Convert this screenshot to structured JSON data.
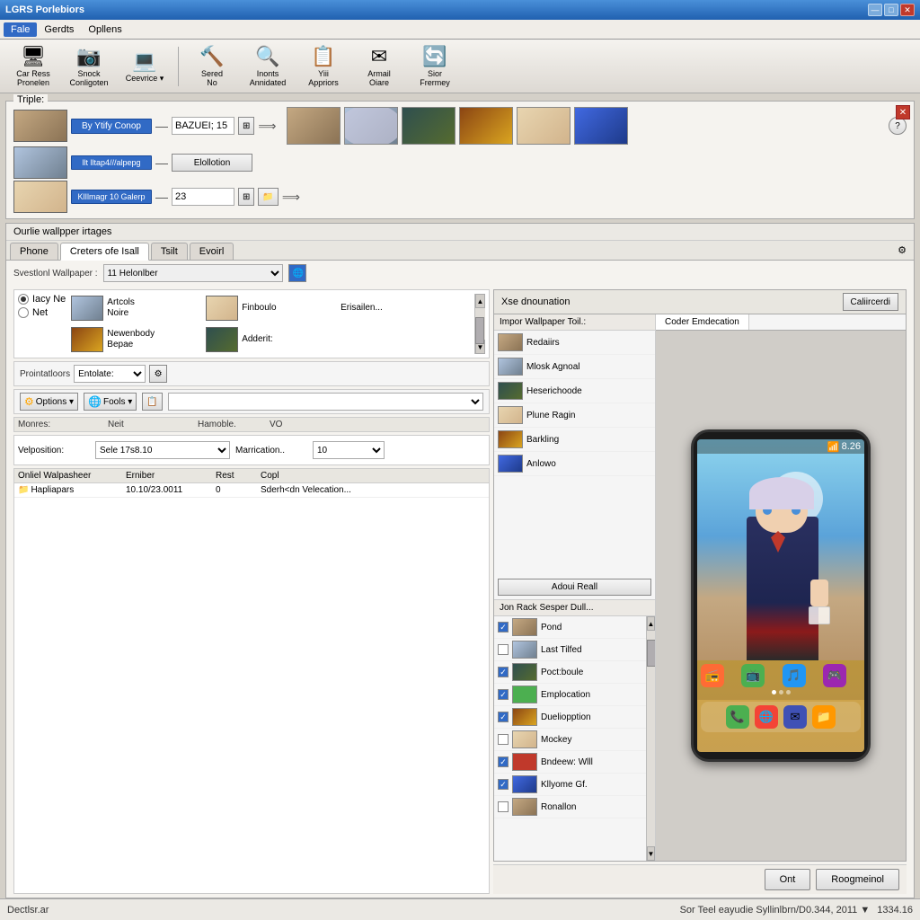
{
  "window": {
    "title": "LGRS Porlebiors",
    "controls": {
      "min": "—",
      "max": "□",
      "close": "✕"
    }
  },
  "menubar": {
    "items": [
      "Fale",
      "Gerdts",
      "Opllens"
    ]
  },
  "toolbar": {
    "buttons": [
      {
        "label": "Car Ress\nPronelen",
        "icon": "🖥"
      },
      {
        "label": "Snock\nConligoten",
        "icon": "📷"
      },
      {
        "label": "Ceevrice",
        "icon": "💻"
      },
      {
        "label": "Sered\nNo",
        "icon": "🔨"
      },
      {
        "label": "Inonts\nAnnidated",
        "icon": "🔍"
      },
      {
        "label": "Yiii\nAppriors",
        "icon": "📋"
      },
      {
        "label": "Armail\nOiare",
        "icon": "✉"
      },
      {
        "label": "Sior\nFrermey",
        "icon": "🔄"
      }
    ]
  },
  "triple_panel": {
    "title": "Triple:",
    "rows": [
      {
        "label": "By Ytify Conop",
        "value": "BAZUEI; 15"
      },
      {
        "label": "llt lltap4///alpepg",
        "btn": "Elollotion"
      },
      {
        "label": "KlIlmagr 10 Galerp",
        "value": "23"
      }
    ]
  },
  "strip_thumbs": [
    {
      "id": 1
    },
    {
      "id": 2
    },
    {
      "id": 3
    },
    {
      "id": 4
    },
    {
      "id": 5
    },
    {
      "id": 6
    }
  ],
  "wallpaper_section": {
    "title": "Ourlie wallpper irtages",
    "tabs": [
      "Phone",
      "Creters ofe Isall",
      "Tsilt",
      "Evoirl"
    ]
  },
  "section_dropdown": {
    "label": "Svestlonl Wallpaper :",
    "value": "11 Helonlber"
  },
  "left_items_grid": [
    {
      "name": "Artcols Noire",
      "has_thumb": true
    },
    {
      "name": "Finboulo",
      "has_thumb": true
    },
    {
      "name": "Erisailen...",
      "has_thumb": false
    },
    {
      "name": "Newenbody\nBepae",
      "has_thumb": true
    },
    {
      "name": "Adderit:",
      "has_thumb": true
    }
  ],
  "radio_items": [
    {
      "label": "Iacy Ne"
    },
    {
      "label": "Net"
    }
  ],
  "params_row": {
    "label": "Prointatloors",
    "dropdown": "Entolate:"
  },
  "options_row": {
    "options_label": "Options",
    "fools_label": "Fools"
  },
  "table": {
    "columns": [
      "Monres:",
      "Neit",
      "Hamoble.",
      "VO"
    ],
    "rows": [
      {
        "col1": "Velposition:",
        "col2": "Sele 17s8.10",
        "col3": "Marrication..",
        "col4": "10"
      }
    ]
  },
  "wallpaper_table": {
    "columns": [
      "Onliel Walpasheer",
      "Erniber",
      "Rest",
      "Copl"
    ],
    "rows": [
      {
        "col1": "Hapliapars",
        "col2": "10.10/23.0011",
        "col3": "0",
        "col4": "Sderh<dn Velecation..."
      }
    ]
  },
  "xse_panel": {
    "title": "Xse dnounation",
    "cancel_btn": "Caliircerdi",
    "left_header": "Impor Wallpaper Toil.:",
    "wp_items": [
      {
        "name": "Redaiirs",
        "checked": false
      },
      {
        "name": "Mlosk Agnoal",
        "checked": false
      },
      {
        "name": "Heserichoode",
        "checked": false
      },
      {
        "name": "Plune Ragin",
        "checked": false
      },
      {
        "name": "Barkling",
        "checked": false
      },
      {
        "name": "Anlowo",
        "checked": false
      }
    ],
    "add_all_btn": "Adoui Reall",
    "sep_label": "Jon Rack Sesper Dull...",
    "coder_tab": "Coder Emdecation",
    "check_items": [
      {
        "name": "Pond",
        "checked": true
      },
      {
        "name": "Last Tilfed",
        "checked": false
      },
      {
        "name": "Poct:boule",
        "checked": true
      },
      {
        "name": "Emplocation",
        "checked": true
      },
      {
        "name": "Dueliopption",
        "checked": true
      },
      {
        "name": "Mockey",
        "checked": false
      },
      {
        "name": "Bndeew: Wlll",
        "checked": true
      },
      {
        "name": "Kllyome Gf.",
        "checked": true
      },
      {
        "name": "Ronallon",
        "checked": false
      }
    ]
  },
  "phone_preview": {
    "status": "8.26",
    "icons": [
      "📻",
      "📺",
      "🎵",
      "🎮"
    ],
    "dock_icons": [
      "📞",
      "🌐",
      "✉",
      "📁"
    ]
  },
  "bottom_buttons": {
    "ok": "Ont",
    "cancel": "Roogmeinol"
  },
  "status_bar": {
    "left": "Dectlsr.ar",
    "right_info": "Sor Teel eayudie Syllinlbrn/D0.344, 2011 ▼",
    "right_num": "1334.16"
  }
}
